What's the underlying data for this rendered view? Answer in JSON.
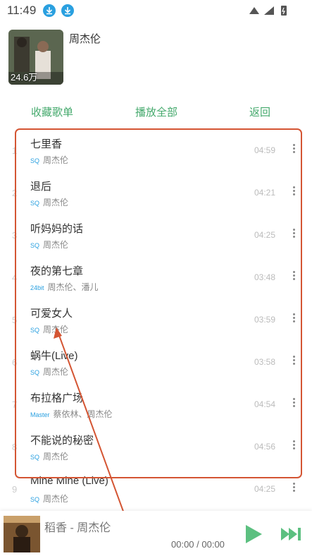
{
  "status_bar": {
    "time": "11:49"
  },
  "header": {
    "artist_name": "周杰伦",
    "play_count": "24.6万"
  },
  "actions": {
    "collect": "收藏歌单",
    "play_all": "播放全部",
    "back": "返回"
  },
  "songs": [
    {
      "index": "1",
      "title": "七里香",
      "badge": "SQ",
      "artists": "周杰伦",
      "duration": "04:59"
    },
    {
      "index": "2",
      "title": "退后",
      "badge": "SQ",
      "artists": "周杰伦",
      "duration": "04:21"
    },
    {
      "index": "3",
      "title": "听妈妈的话",
      "badge": "SQ",
      "artists": "周杰伦",
      "duration": "04:25"
    },
    {
      "index": "4",
      "title": "夜的第七章",
      "badge": "24bit",
      "artists": "周杰伦、潘儿",
      "duration": "03:48"
    },
    {
      "index": "5",
      "title": "可爱女人",
      "badge": "SQ",
      "artists": "周杰伦",
      "duration": "03:59"
    },
    {
      "index": "6",
      "title": "蜗牛(Live)",
      "badge": "SQ",
      "artists": "周杰伦",
      "duration": "03:58"
    },
    {
      "index": "7",
      "title": "布拉格广场",
      "badge": "Master",
      "artists": "蔡依林、周杰伦",
      "duration": "04:54"
    },
    {
      "index": "8",
      "title": "不能说的秘密",
      "badge": "SQ",
      "artists": "周杰伦",
      "duration": "04:56"
    },
    {
      "index": "9",
      "title": "Mine Mine (Live)",
      "badge": "SQ",
      "artists": "周杰伦",
      "duration": "04:25"
    }
  ],
  "player": {
    "now_playing": "稻香 - 周杰伦",
    "time": "00:00 / 00:00"
  },
  "colors": {
    "accent": "#44a96c",
    "badge": "#2aa0e0",
    "annotation": "#d45533"
  }
}
